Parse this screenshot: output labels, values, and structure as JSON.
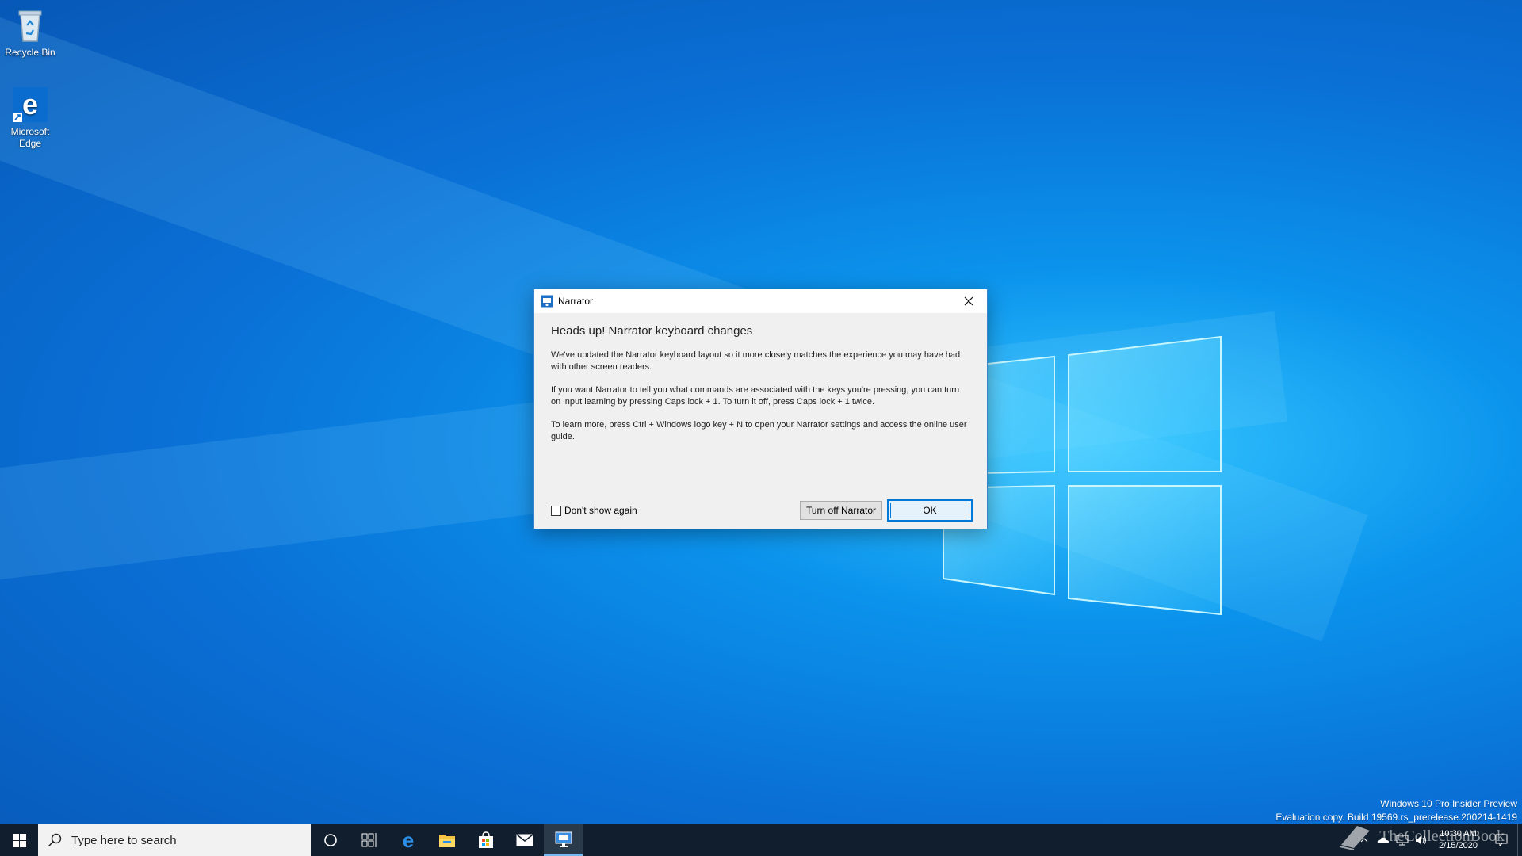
{
  "desktop": {
    "icons": [
      {
        "label": "Recycle Bin",
        "icon": "recycle-bin-icon"
      },
      {
        "label": "Microsoft Edge",
        "icon": "edge-icon"
      }
    ]
  },
  "dialog": {
    "title": "Narrator",
    "heading": "Heads up! Narrator keyboard changes",
    "paragraphs": [
      "We've updated the Narrator keyboard layout so it more closely matches the experience you may have had with other screen readers.",
      "If you want Narrator to tell you what commands are associated with the keys you're pressing, you can turn on input learning by pressing Caps lock + 1. To turn it off, press Caps lock + 1 twice.",
      "To learn more, press Ctrl + Windows logo key + N to open your Narrator settings and access the online user guide."
    ],
    "checkbox_label": "Don't show again",
    "checkbox_checked": false,
    "turn_off_label": "Turn off Narrator",
    "ok_label": "OK"
  },
  "watermark": {
    "line1": "Windows 10 Pro Insider Preview",
    "line2": "Evaluation copy. Build 19569.rs_prerelease.200214-1419"
  },
  "taskbar": {
    "search_placeholder": "Type here to search",
    "pinned": [
      "cortana-icon",
      "task-view-icon",
      "edge-icon",
      "file-explorer-icon",
      "store-icon",
      "mail-icon",
      "narrator-icon"
    ],
    "clock_time": "10:30 AM",
    "clock_date": "2/15/2020"
  },
  "site_watermark": "TheCollectionBook",
  "colors": {
    "accent": "#0078d7",
    "taskbar": "#101e2d"
  }
}
